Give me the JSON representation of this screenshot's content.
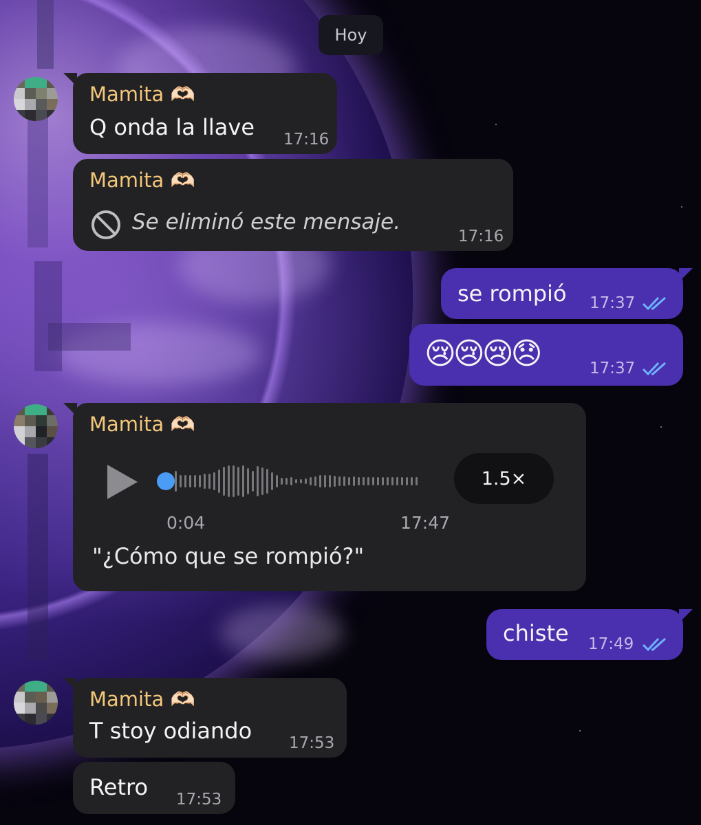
{
  "date_separator": "Hoy",
  "contact_name": "Mamita 🫶🏻",
  "messages": [
    {
      "direction": "in",
      "text": "Q onda la llave",
      "time": "17:16"
    },
    {
      "direction": "in",
      "deleted": true,
      "text": "Se eliminó este mensaje.",
      "time": "17:16"
    },
    {
      "direction": "out",
      "text": "se rompió",
      "time": "17:37",
      "status": "read"
    },
    {
      "direction": "out",
      "text": "😢😢😢😞",
      "time": "17:37",
      "status": "read"
    },
    {
      "direction": "in",
      "type": "voice",
      "duration": "0:04",
      "time": "17:47",
      "speed": "1.5×",
      "transcript": "\"¿Cómo que se rompió?\""
    },
    {
      "direction": "out",
      "text": "chiste",
      "time": "17:49",
      "status": "read"
    },
    {
      "direction": "in",
      "text": "T stoy odiando",
      "time": "17:53"
    },
    {
      "direction": "in",
      "text": "Retro",
      "time": "17:53"
    }
  ],
  "icons": {
    "read_receipt": "double-check-icon",
    "deleted": "no-entry-icon",
    "play": "play-icon"
  },
  "colors": {
    "incoming_bubble": "#222224",
    "outgoing_bubble": "#4a2fae",
    "sender_name": "#f3c77a",
    "read_ticks": "#6db3ff",
    "voice_dot": "#4a9cf5"
  }
}
